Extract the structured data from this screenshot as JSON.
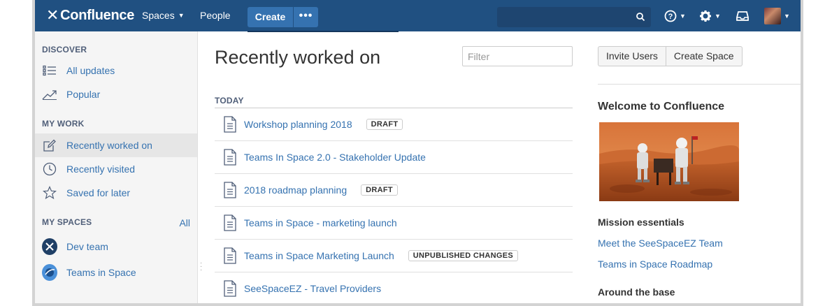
{
  "header": {
    "logo_text": "Confluence",
    "nav": {
      "spaces": "Spaces",
      "people": "People"
    },
    "create": "Create",
    "more": "•••",
    "search_placeholder": "",
    "brand_color": "#205081"
  },
  "sidebar": {
    "discover_heading": "DISCOVER",
    "discover_items": [
      {
        "label": "All updates",
        "icon": "list-icon"
      },
      {
        "label": "Popular",
        "icon": "trend-icon"
      }
    ],
    "mywork_heading": "MY WORK",
    "mywork_items": [
      {
        "label": "Recently worked on",
        "icon": "edit-icon",
        "active": true
      },
      {
        "label": "Recently visited",
        "icon": "clock-icon"
      },
      {
        "label": "Saved for later",
        "icon": "star-icon"
      }
    ],
    "myspaces_heading": "MY SPACES",
    "myspaces_all": "All",
    "spaces": [
      {
        "label": "Dev team",
        "icon": "dev-team-avatar"
      },
      {
        "label": "Teams in Space",
        "icon": "teams-in-space-avatar"
      }
    ]
  },
  "main": {
    "title": "Recently worked on",
    "filter_placeholder": "Filter",
    "section": "TODAY",
    "items": [
      {
        "title": "Workshop planning 2018",
        "badge": "DRAFT"
      },
      {
        "title": "Teams In Space 2.0 - Stakeholder Update",
        "badge": ""
      },
      {
        "title": "2018 roadmap planning",
        "badge": "DRAFT"
      },
      {
        "title": "Teams in Space - marketing launch",
        "badge": ""
      },
      {
        "title": "Teams in Space Marketing Launch",
        "badge": "UNPUBLISHED CHANGES"
      },
      {
        "title": "SeeSpaceEZ - Travel Providers",
        "badge": ""
      }
    ]
  },
  "right": {
    "invite": "Invite Users",
    "create_space": "Create Space",
    "welcome": "Welcome to Confluence",
    "mission": "Mission essentials",
    "links": [
      "Meet the SeeSpaceEZ Team",
      "Teams in Space Roadmap"
    ],
    "around": "Around the base"
  }
}
